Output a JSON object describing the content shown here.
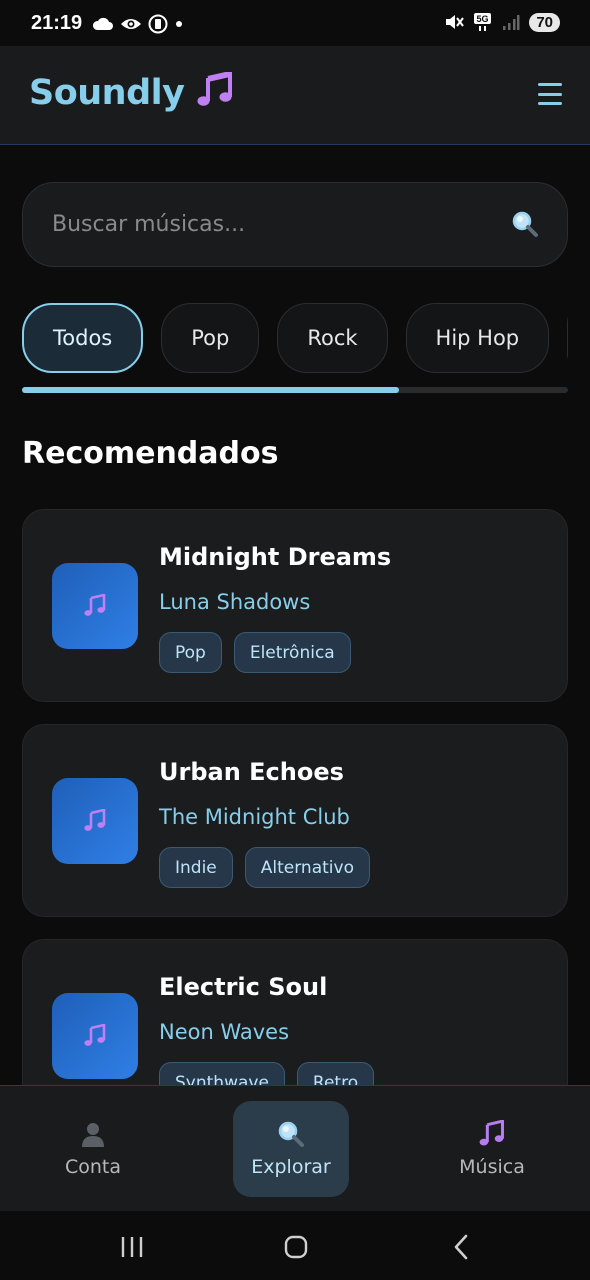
{
  "status_bar": {
    "time": "21:19",
    "battery": "70"
  },
  "header": {
    "title": "Soundly",
    "title_icon": "musical-notes-icon",
    "menu_icon": "hamburger-menu-icon"
  },
  "search": {
    "placeholder": "Buscar músicas...",
    "icon": "magnifier-icon"
  },
  "filters": {
    "chips": [
      "Todos",
      "Pop",
      "Rock",
      "Hip Hop"
    ],
    "active": "Todos",
    "scroll_progress": 0.69
  },
  "section": {
    "title": "Recomendados"
  },
  "songs": [
    {
      "title": "Midnight Dreams",
      "artist": "Luna Shadows",
      "tags": [
        "Pop",
        "Eletrônica"
      ]
    },
    {
      "title": "Urban Echoes",
      "artist": "The Midnight Club",
      "tags": [
        "Indie",
        "Alternativo"
      ]
    },
    {
      "title": "Electric Soul",
      "artist": "Neon Waves",
      "tags": [
        "Synthwave",
        "Retro"
      ]
    }
  ],
  "bottom_nav": {
    "items": [
      {
        "label": "Conta",
        "icon": "user-silhouette-icon"
      },
      {
        "label": "Explorar",
        "icon": "magnifier-icon"
      },
      {
        "label": "Música",
        "icon": "musical-notes-icon"
      }
    ],
    "active": "Explorar"
  },
  "colors": {
    "accent": "#87ceeb",
    "background": "#0c0c0c",
    "surface": "#1b1c1e",
    "cover_gradient_start": "#1f5fb8",
    "cover_gradient_end": "#2f7fe6",
    "note": "#b77cf0"
  }
}
